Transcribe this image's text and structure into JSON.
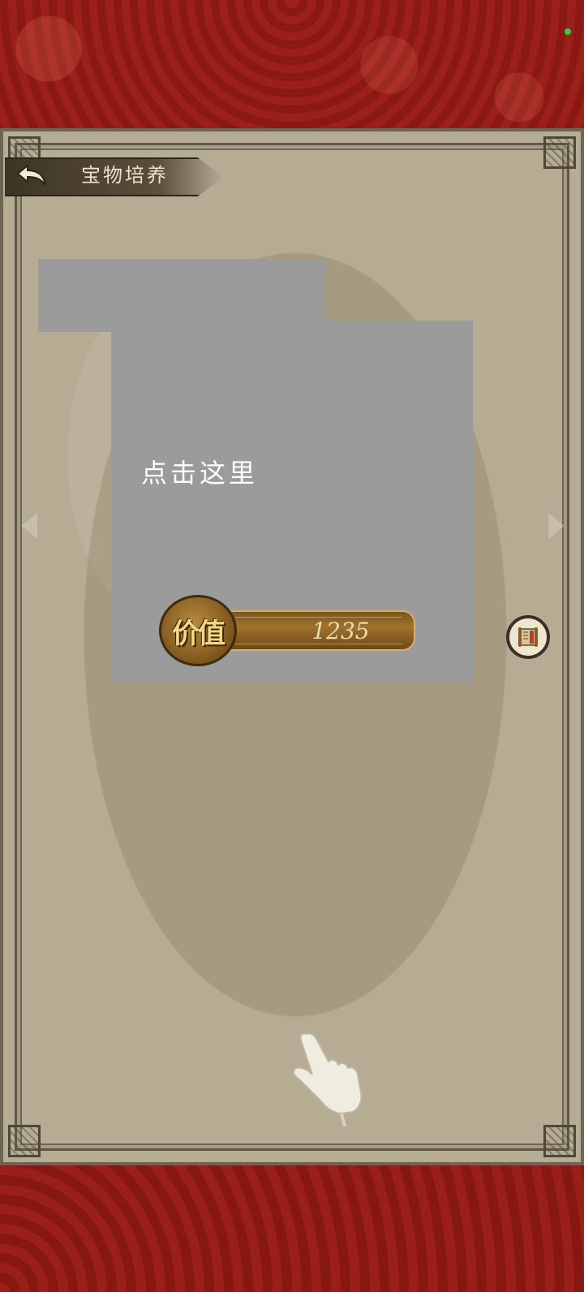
{
  "header": {
    "title": "宝物培养",
    "back_icon": "back-arrow-icon"
  },
  "tutorial": {
    "hint_text": "点击这里",
    "pointer_icon": "tap-hand-icon"
  },
  "treasure": {
    "value_label": "价值",
    "value": "1235"
  },
  "side_button": {
    "icon": "scroll-icon"
  },
  "colors": {
    "background_red": "#8e1a15",
    "parchment": "#b6ac94",
    "mask_gray": "#9b9b9b",
    "gold": "#a0732c"
  }
}
